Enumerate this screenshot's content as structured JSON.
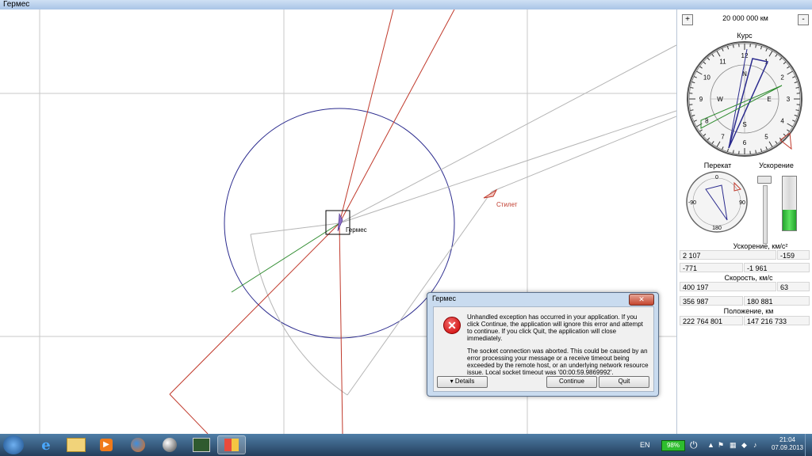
{
  "window": {
    "title": "Гермес"
  },
  "map": {
    "ship_label": "Гермес",
    "target_label": "Стилет",
    "colors": {
      "grid": "#c8c8c8",
      "orbit": "#2b2b8e",
      "course": "#c0392b",
      "vector": "#2e8b2e",
      "track": "#b0b0b0"
    }
  },
  "panel": {
    "zoom_in": "+",
    "zoom_out": "-",
    "scale": "20 000 000 км",
    "course_title": "Курс",
    "compass": {
      "hours": [
        "12",
        "1",
        "2",
        "3",
        "4",
        "5",
        "6",
        "7",
        "8",
        "9",
        "10",
        "11"
      ],
      "cardinals": {
        "n": "N",
        "s": "S",
        "e": "E",
        "w": "W"
      }
    },
    "roll_title": "Перекат",
    "roll_ticks": {
      "top": "0",
      "right": "90",
      "bottom": "180",
      "left": "-90"
    },
    "accel_title": "Ускорение",
    "accel_level": 0.38,
    "acceleration_title": "Ускорение, км/с²",
    "acceleration": {
      "a": "2 107",
      "b": "-159",
      "c": "-771",
      "d": "-1 961"
    },
    "speed_title": "Скорость, км/с",
    "speed": {
      "a": "400 197",
      "b": "63",
      "c": "356 987",
      "d": "180 881"
    },
    "position_title": "Положение, км",
    "position": {
      "a": "222 764 801",
      "b": "147 216 733"
    }
  },
  "dialog": {
    "title": "Гермес",
    "close": "✕",
    "message1": "Unhandled exception has occurred in your application. If you click Continue, the application will ignore this error and attempt to continue. If you click Quit, the application will close immediately.",
    "message2": "The socket connection was aborted. This could be caused by an error processing your message or a receive timeout being exceeded by the remote host, or an underlying network resource issue. Local socket timeout was '00:00:59.9869992'.",
    "details": "Details",
    "continue": "Continue",
    "quit": "Quit"
  },
  "taskbar": {
    "lang": "EN",
    "battery": "98%",
    "time": "21:04",
    "date": "07.09.2013"
  }
}
